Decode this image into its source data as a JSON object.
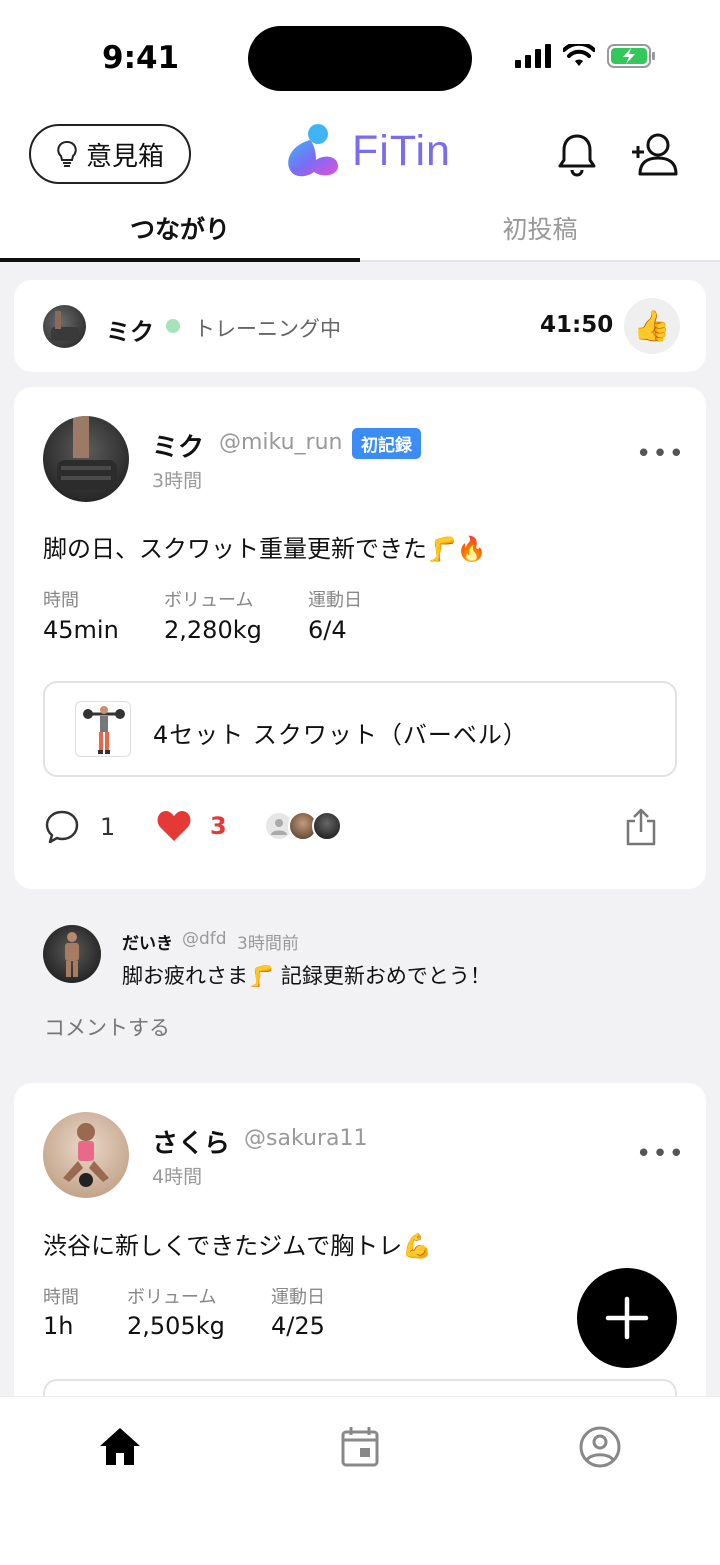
{
  "status_bar": {
    "time": "9:41"
  },
  "header": {
    "feedback_label": "意見箱",
    "logo_text": "FiTin",
    "tabs": [
      {
        "label": "つながり",
        "active": true
      },
      {
        "label": "初投稿",
        "active": false
      }
    ]
  },
  "live_session": {
    "user": "ミク",
    "status": "トレーニング中",
    "timer": "41:50",
    "reaction": "👍"
  },
  "posts": [
    {
      "name": "ミク",
      "handle": "@miku_run",
      "badge": "初記録",
      "ago": "3時間",
      "text": "脚の日、スクワット重量更新できた🦵🔥",
      "stats": [
        {
          "label": "時間",
          "value": "45min"
        },
        {
          "label": "ボリューム",
          "value": "2,280kg"
        },
        {
          "label": "運動日",
          "value": "6/4"
        }
      ],
      "exercise": "4セット  スクワット（バーベル）",
      "comments_count": "1",
      "likes_count": "3"
    },
    {
      "name": "さくら",
      "handle": "@sakura11",
      "ago": "4時間",
      "text": "渋谷に新しくできたジムで胸トレ💪",
      "stats": [
        {
          "label": "時間",
          "value": "1h"
        },
        {
          "label": "ボリューム",
          "value": "2,505kg"
        },
        {
          "label": "運動日",
          "value": "4/25"
        }
      ]
    }
  ],
  "comment": {
    "name": "だいき",
    "handle": "@dfd",
    "ago": "3時間前",
    "text": "脚お疲れさま🦵 記録更新おめでとう！",
    "prompt": "コメントする"
  },
  "colors": {
    "accent_blue": "#3b8cf5",
    "like_red": "#e53935",
    "live_green": "#a6e3b8",
    "logo_purple": "#7a6cf0"
  }
}
